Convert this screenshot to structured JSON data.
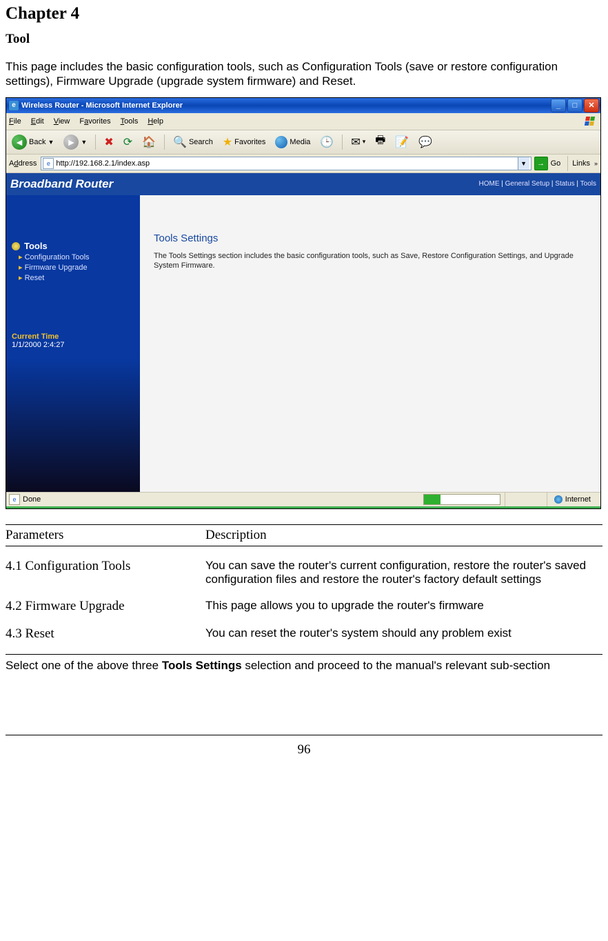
{
  "doc": {
    "chapter_title": "Chapter 4",
    "section_title": "Tool",
    "intro": "This page includes the basic configuration tools, such as Configuration Tools (save or restore configuration settings), Firmware Upgrade (upgrade system firmware) and Reset.",
    "footnote_prefix": "Select one of the above three ",
    "footnote_bold": "Tools Settings",
    "footnote_suffix": " selection and proceed to the manual's relevant sub-section",
    "page_number": "96"
  },
  "table": {
    "header_param": "Parameters",
    "header_desc": "Description",
    "rows": [
      {
        "param": "4.1 Configuration Tools",
        "desc": "You can save the router's current configuration, restore the router's saved configuration files and restore the router's factory default settings"
      },
      {
        "param": "4.2 Firmware Upgrade",
        "desc": "This page allows you to upgrade the router's firmware"
      },
      {
        "param": "4.3 Reset",
        "desc": "You can reset the router's system should any problem exist"
      }
    ]
  },
  "ie": {
    "title": "Wireless Router - Microsoft Internet Explorer",
    "menu": {
      "file": "File",
      "edit": "Edit",
      "view": "View",
      "favorites": "Favorites",
      "tools": "Tools",
      "help": "Help"
    },
    "toolbar": {
      "back": "Back",
      "search": "Search",
      "favorites": "Favorites",
      "media": "Media"
    },
    "address_label": "Address",
    "address_value": "http://192.168.2.1/index.asp",
    "go": "Go",
    "links": "Links",
    "status_done": "Done",
    "status_zone": "Internet"
  },
  "router": {
    "brand": "Broadband Router",
    "nav": {
      "home": "HOME",
      "general": "General Setup",
      "status": "Status",
      "tools": "Tools"
    },
    "sidebar": {
      "title": "Tools",
      "items": [
        "Configuration Tools",
        "Firmware Upgrade",
        "Reset"
      ],
      "current_time_label": "Current Time",
      "current_time_value": "1/1/2000 2:4:27"
    },
    "main": {
      "title": "Tools Settings",
      "desc": "The Tools Settings section includes the basic configuration tools, such as Save, Restore Configuration Settings, and Upgrade System Firmware."
    }
  }
}
